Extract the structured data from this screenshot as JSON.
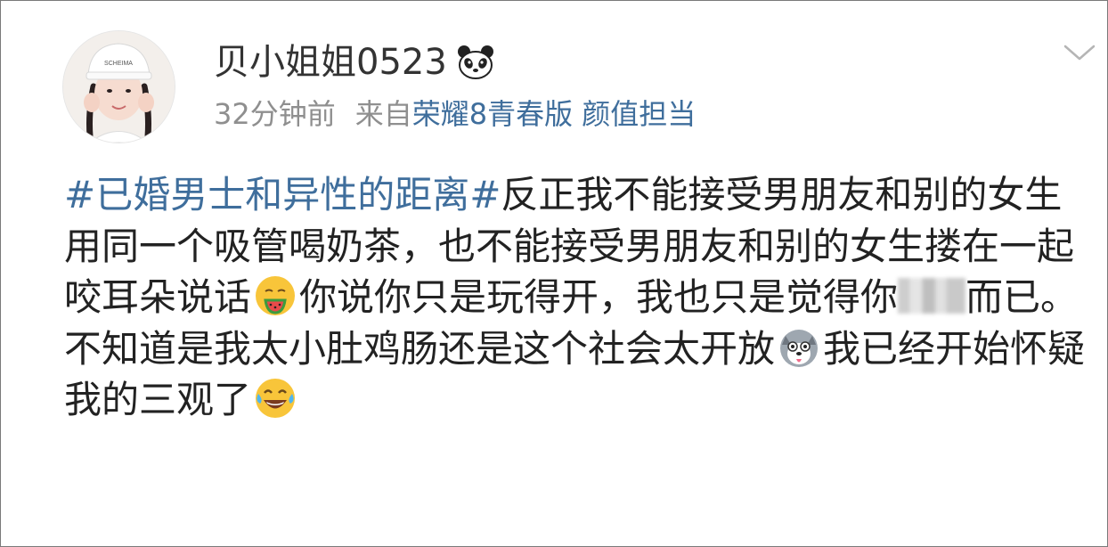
{
  "post": {
    "username": "贝小姐姐0523",
    "badge_icon": "panda-icon",
    "time": "32分钟前",
    "from_prefix": "来自",
    "source": "荣耀8青春版 颜值担当",
    "menu_icon": "chevron-down-icon",
    "avatar_hat_text": "SCHEIMA",
    "content": {
      "topic": "#已婚男士和异性的距离#",
      "text_1": "反正我不能接受男朋友和别的女生用同一个吸管喝奶茶，也不能接受男朋友和别的女生搂在一起咬耳朵说话",
      "emoji_1": "watermelon-emoji-icon",
      "text_2": "你说你只是玩得开，我也只是觉得你",
      "text_3": "而已。",
      "text_4": "不知道是我太小肚鸡肠还是这个社会太开放",
      "emoji_2": "husky-emoji-icon",
      "text_5": "我已经开始怀疑我的三观了",
      "emoji_3": "laughing-tears-emoji-icon"
    }
  },
  "colors": {
    "link": "#3f6e9c",
    "text": "#222222",
    "meta": "#8f8f8f",
    "border": "#7a7a7a"
  }
}
